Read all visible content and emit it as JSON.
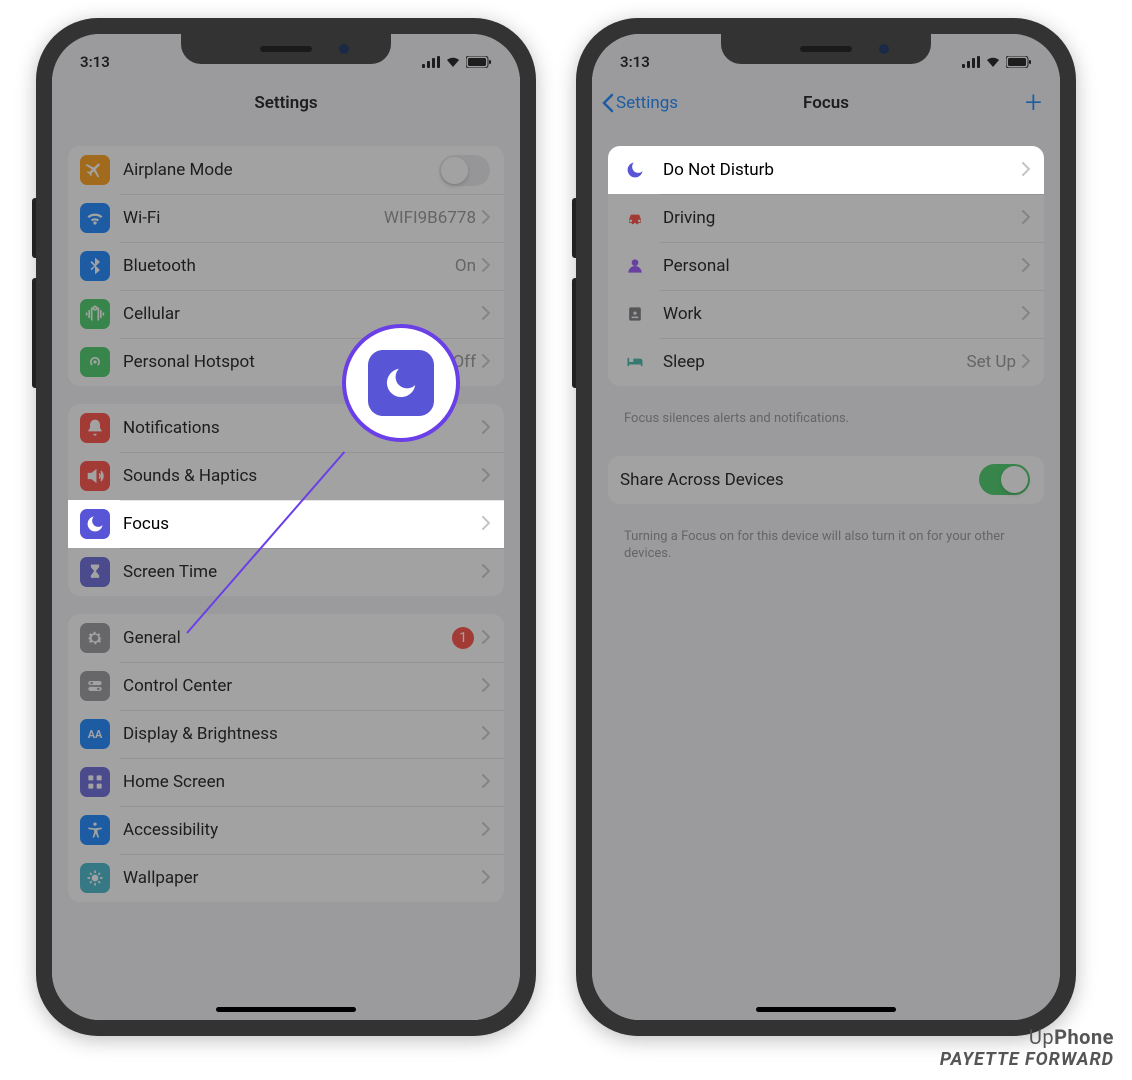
{
  "status": {
    "time": "3:13"
  },
  "phone1": {
    "title": "Settings",
    "g1": [
      {
        "icon": "airplane",
        "color": "ic-orange",
        "label": "Airplane Mode",
        "toggle": false
      },
      {
        "icon": "wifi",
        "color": "ic-blue",
        "label": "Wi-Fi",
        "value": "WIFI9B6778"
      },
      {
        "icon": "bluetooth",
        "color": "ic-blue",
        "label": "Bluetooth",
        "value": "On"
      },
      {
        "icon": "cellular",
        "color": "ic-green",
        "label": "Cellular"
      },
      {
        "icon": "hotspot",
        "color": "ic-green",
        "label": "Personal Hotspot",
        "value": "Off"
      }
    ],
    "g2": [
      {
        "icon": "bell",
        "color": "ic-red",
        "label": "Notifications"
      },
      {
        "icon": "speaker",
        "color": "ic-red",
        "label": "Sounds & Haptics"
      },
      {
        "icon": "moon",
        "color": "ic-purple",
        "label": "Focus",
        "highlight": true
      },
      {
        "icon": "hourglass",
        "color": "ic-purple",
        "label": "Screen Time"
      }
    ],
    "g3": [
      {
        "icon": "gear",
        "color": "ic-gray",
        "label": "General",
        "badge": "1"
      },
      {
        "icon": "switches",
        "color": "ic-gray",
        "label": "Control Center"
      },
      {
        "icon": "aa",
        "color": "ic-blue",
        "label": "Display & Brightness"
      },
      {
        "icon": "grid",
        "color": "ic-lav",
        "label": "Home Screen"
      },
      {
        "icon": "accessibility",
        "color": "ic-blue",
        "label": "Accessibility"
      },
      {
        "icon": "wallpaper",
        "color": "ic-teal",
        "label": "Wallpaper"
      }
    ]
  },
  "phone2": {
    "back": "Settings",
    "title": "Focus",
    "items": [
      {
        "icon": "moon",
        "cls": "plain",
        "label": "Do Not Disturb",
        "highlight": true
      },
      {
        "icon": "car",
        "cls": "plain car",
        "label": "Driving"
      },
      {
        "icon": "person",
        "cls": "plain person",
        "label": "Personal"
      },
      {
        "icon": "badge-id",
        "cls": "plain work",
        "label": "Work"
      },
      {
        "icon": "bed",
        "cls": "plain sleep",
        "label": "Sleep",
        "value": "Set Up"
      }
    ],
    "hint": "Focus silences alerts and notifications.",
    "share": {
      "label": "Share Across Devices",
      "on": true
    },
    "share_hint": "Turning a Focus on for this device will also turn it on for your other devices."
  },
  "watermark": {
    "line1a": "Up",
    "line1b": "Phone",
    "line2": "PAYETTE FORWARD"
  }
}
